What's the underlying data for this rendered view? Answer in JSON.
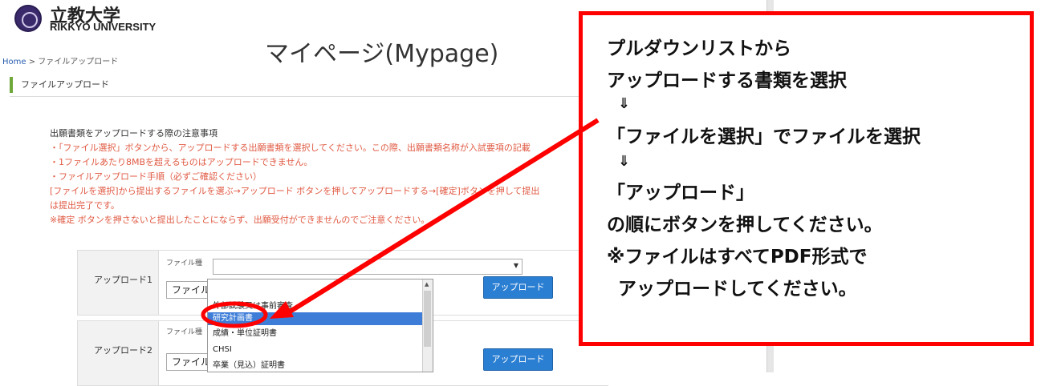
{
  "header": {
    "univ_jp": "立教大学",
    "univ_en": "RIKKYO UNIVERSITY",
    "page_title": "マイページ(Mypage)"
  },
  "breadcrumb": {
    "home": "Home",
    "sep": " > ",
    "current": "ファイルアップロード"
  },
  "section_title": "ファイルアップロード",
  "notices": {
    "title": "出願書類をアップロードする際の注意事項",
    "lines": [
      "・「ファイル選択」ボタンから、アップロードする出願書類を選択してください。この際、出願書類名称が入試要項の記載",
      "・1ファイルあたり8MBを超えるものはアップロードできません。",
      "・ファイルアップロード手順（必ずご確認ください）",
      "[ファイルを選択]から提出するファイルを選ぶ→アップロード ボタンを押してアップロードする→[確定]ボタンを押して提出",
      "は提出完了です。",
      "※確定 ボタンを押さないと提出したことにならず、出願受付ができませんのでご注意ください。"
    ]
  },
  "uploads": [
    {
      "label": "アップロード1",
      "file_caption": "ファイル種",
      "file_button": "ファイル",
      "upload_button": "アップロード"
    },
    {
      "label": "アップロード2",
      "file_caption": "ファイル種",
      "file_button": "ファイル",
      "upload_button": "アップロード"
    }
  ],
  "dropdown": {
    "items": [
      "外部試験又は事前審査",
      "研究計画書",
      "成績・単位証明書",
      "CHSI",
      "卒業（見込）証明書"
    ],
    "selected": "研究計画書"
  },
  "callout": {
    "lines": [
      "プルダウンリストから",
      "アップロードする書類を選択",
      "⇓",
      "「ファイルを選択」でファイルを選択",
      "⇓",
      "「アップロード」",
      "の順にボタンを押してください。",
      "※ファイルはすべてPDF形式で",
      "アップロードしてください。"
    ]
  },
  "colors": {
    "callout_border": "#ff0000",
    "upload_button": "#2b7fd3",
    "notice_text": "#e05a43",
    "selected_item": "#3d7dd8"
  }
}
